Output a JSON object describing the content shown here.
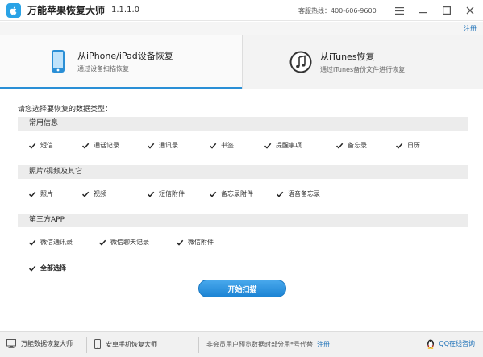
{
  "window": {
    "title": "万能苹果恢复大师",
    "version": "1.1.1.0",
    "hotline": "客服热线：400-606-9600",
    "menu_icon": "hamburger-icon",
    "minimize_icon": "minimize-icon",
    "maximize_icon": "maximize-icon",
    "close_icon": "close-icon"
  },
  "register_top": "注册",
  "tabs": [
    {
      "title": "从iPhone/iPad设备恢复",
      "subtitle": "通过设备扫描恢复",
      "icon": "iphone-icon",
      "active": true
    },
    {
      "title": "从iTunes恢复",
      "subtitle": "通过iTunes备份文件进行恢复",
      "icon": "music-note-icon",
      "active": false
    }
  ],
  "prompt": "请您选择要恢复的数据类型：",
  "groups": [
    {
      "title": "常用信息",
      "items": [
        "短信",
        "通话记录",
        "通讯录",
        "书签",
        "提醒事项",
        "备忘录",
        "日历"
      ]
    },
    {
      "title": "照片/视频及其它",
      "items": [
        "照片",
        "视频",
        "短信附件",
        "备忘录附件",
        "语音备忘录"
      ]
    },
    {
      "title": "第三方APP",
      "items": [
        "微信通讯录",
        "微信聊天记录",
        "微信附件"
      ]
    }
  ],
  "select_all": "全部选择",
  "scan_button": "开始扫描",
  "footer": {
    "item1": "万能数据恢复大师",
    "item2": "安卓手机恢复大师",
    "notice": "非会员用户预览数据时部分用*号代替",
    "register": "注册",
    "qq": "QQ在线咨询"
  },
  "colors": {
    "accent": "#2a8fd6",
    "link": "#1a6fb7",
    "header_bg": "#ececec"
  }
}
